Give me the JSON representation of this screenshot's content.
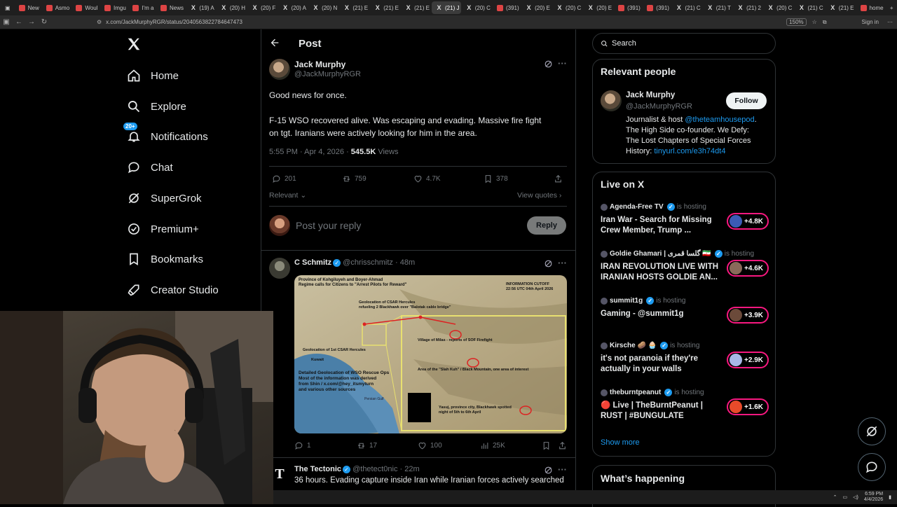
{
  "browser": {
    "tabs": [
      {
        "label": "New",
        "icon": "page-icon"
      },
      {
        "label": "Asmo",
        "icon": "page-icon"
      },
      {
        "label": "Woul",
        "icon": "page-icon"
      },
      {
        "label": "Imgu",
        "icon": "page-icon"
      },
      {
        "label": "I'm a",
        "icon": "page-icon"
      },
      {
        "label": "News",
        "icon": "page-icon"
      },
      {
        "label": "(19) A",
        "icon": "x-icon"
      },
      {
        "label": "(20) H",
        "icon": "x-icon"
      },
      {
        "label": "(20) F",
        "icon": "x-icon"
      },
      {
        "label": "(20) A",
        "icon": "x-icon"
      },
      {
        "label": "(20) N",
        "icon": "x-icon"
      },
      {
        "label": "(21) E",
        "icon": "x-icon"
      },
      {
        "label": "(21) E",
        "icon": "x-icon"
      },
      {
        "label": "(21) E",
        "icon": "x-icon"
      },
      {
        "label": "(21) J",
        "icon": "x-icon"
      },
      {
        "label": "(20) C",
        "icon": "x-icon"
      },
      {
        "label": "(391)",
        "icon": "page-icon"
      },
      {
        "label": "(20) E",
        "icon": "x-icon"
      },
      {
        "label": "(20) C",
        "icon": "x-icon"
      },
      {
        "label": "(20) E",
        "icon": "x-icon"
      },
      {
        "label": "(391)",
        "icon": "page-icon"
      },
      {
        "label": "(391)",
        "icon": "page-icon"
      },
      {
        "label": "(21) C",
        "icon": "x-icon"
      },
      {
        "label": "(21) T",
        "icon": "x-icon"
      },
      {
        "label": "(21) 2",
        "icon": "x-icon"
      },
      {
        "label": "(20) C",
        "icon": "x-icon"
      },
      {
        "label": "(21) C",
        "icon": "x-icon"
      },
      {
        "label": "(21) E",
        "icon": "x-icon"
      },
      {
        "label": "home",
        "icon": "page-icon"
      }
    ],
    "url": "x.com/JackMurphyRGR/status/2040563822784647473",
    "zoom": "150%",
    "sign_in": "Sign in"
  },
  "nav": {
    "items": [
      {
        "label": "Home",
        "icon": "home-icon"
      },
      {
        "label": "Explore",
        "icon": "search-icon"
      },
      {
        "label": "Notifications",
        "icon": "bell-icon",
        "badge": "20+"
      },
      {
        "label": "Chat",
        "icon": "chat-icon"
      },
      {
        "label": "SuperGrok",
        "icon": "grok-icon"
      },
      {
        "label": "Premium+",
        "icon": "verified-icon"
      },
      {
        "label": "Bookmarks",
        "icon": "bookmark-icon"
      },
      {
        "label": "Creator Studio",
        "icon": "rocket-icon"
      }
    ]
  },
  "post": {
    "header_title": "Post",
    "author_name": "Jack Murphy",
    "author_handle": "@JackMurphyRGR",
    "text_line1": "Good news for once.",
    "text_line2": "F-15 WSO recovered alive. Was escaping and evading. Massive fire fight",
    "text_line3": "on tgt. Iranians were actively looking for him in the area.",
    "timestamp": "5:55 PM · Apr 4, 2026 · ",
    "views_count": "545.5K",
    "views_label": " Views",
    "replies": "201",
    "reposts": "759",
    "likes": "4.7K",
    "bookmarks": "378",
    "sort_label": "Relevant",
    "view_quotes": "View quotes",
    "reply_placeholder": "Post your reply",
    "reply_button": "Reply"
  },
  "replies": [
    {
      "name": "C Schmitz",
      "handle": "@chrisschmitz",
      "time": "· 48m",
      "map_labels": {
        "title_left": "Province of Kohgiluyeh and Boyer-Ahmad",
        "title_left2": "Regime calls for Citizens to \"Arrest Pilots for Reward\"",
        "cutoff": "INFORMATION CUTOFF",
        "cutoff_time": "22:56 UTC 04th April 2026",
        "csar": "Geolocation of CSAR Hercules",
        "csar2": "refueling 2 Blackhawk over \"Balotak cable bridge\"",
        "milas": "Village of Milas - reports of SOF Firefight",
        "hercules1": "Geolocation of 1st CSAR Hercules",
        "slah": "Area of the \"Slah Kuh\" / Black Mountain, one area of interest",
        "kuwait": "Kuwait",
        "detailed1": "Detailed Geolocation of WSO Rescue Ops",
        "detailed2": "Most of the information was derived",
        "detailed3": "from Shin / x.com/@hey_itsmyturn",
        "detailed4": "and various other sources",
        "gulf": "Persian Gulf",
        "yasuj1": "Yasuj, province city, Blackhawk spotted",
        "yasuj2": "night of 5th to 6th April"
      },
      "replies": "1",
      "reposts": "17",
      "likes": "100",
      "views": "25K"
    },
    {
      "name": "The Tectonic",
      "handle": "@thetect0nic",
      "time": "· 22m",
      "avatar_letter": "T",
      "text": "36 hours. Evading capture inside Iran while Iranian forces actively searched"
    }
  ],
  "sidebar": {
    "search_placeholder": "Search",
    "relevant_title": "Relevant people",
    "person_name": "Jack Murphy",
    "person_handle": "@JackMurphyRGR",
    "follow_label": "Follow",
    "bio_1": "Journalist & host ",
    "bio_link": "@theteamhousepod",
    "bio_2": ".",
    "bio_3": "The High Side co-founder. We Defy:",
    "bio_4": "The Lost Chapters of Special Forces",
    "bio_5": "History: ",
    "bio_url": "tinyurl.com/e3h74dt4",
    "live_title": "Live on X",
    "live": [
      {
        "host": "Agenda-Free TV",
        "hosting": "is hosting",
        "title": "Iran War - Search for Missing Crew Member, Trump ...",
        "count": "+4.8K",
        "color": "#3b5bb5"
      },
      {
        "host": "Goldie Ghamari | گلسا قمری 🇮🇷",
        "hosting": "is hosting",
        "title": "IRAN REVOLUTION LIVE WITH IRANIAN HOSTS GOLDIE AN...",
        "count": "+4.6K",
        "color": "#8a6a5a"
      },
      {
        "host": "summit1g",
        "hosting": "is hosting",
        "title": "Gaming - @summit1g",
        "count": "+3.9K",
        "color": "#6b4a3a"
      },
      {
        "host": "Kirsche 🥔 🧁",
        "hosting": "is hosting",
        "title": "it's not paranoia if they're actually in your walls",
        "count": "+2.9K",
        "color": "#a8b8e8"
      },
      {
        "host": "theburntpeanut",
        "hosting": "is hosting",
        "title": "🔴 Live | TheBurntPeanut | RUST | #BUNGULATE",
        "count": "+1.6K",
        "color": "#e84a2a"
      }
    ],
    "show_more": "Show more",
    "whats_happening": "What’s happening"
  },
  "taskbar": {
    "time": "6:59 PM",
    "date": "4/4/2026"
  },
  "colors": {
    "accent": "#1d9bf0",
    "live_pink": "#f91880",
    "border": "#2f3336",
    "muted": "#71767b"
  }
}
